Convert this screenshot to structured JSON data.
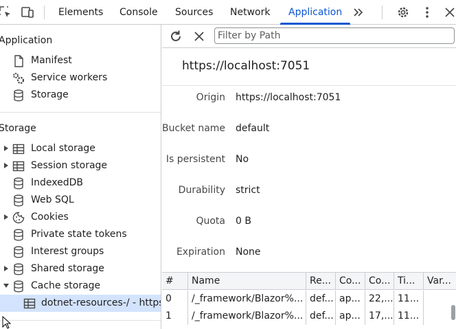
{
  "tabbar": {
    "tabs": [
      "Elements",
      "Console",
      "Sources",
      "Network",
      "Application"
    ],
    "active_tab": "Application",
    "more_label": "»"
  },
  "sidebar": {
    "application_title": "Application",
    "application_items": [
      {
        "label": "Manifest",
        "icon": "file-icon"
      },
      {
        "label": "Service workers",
        "icon": "gears-icon"
      },
      {
        "label": "Storage",
        "icon": "database-icon"
      }
    ],
    "storage_title": "Storage",
    "storage_items": [
      {
        "label": "Local storage",
        "icon": "table-icon",
        "expandable": true
      },
      {
        "label": "Session storage",
        "icon": "table-icon",
        "expandable": true
      },
      {
        "label": "IndexedDB",
        "icon": "database-icon",
        "expandable": false
      },
      {
        "label": "Web SQL",
        "icon": "database-icon",
        "expandable": false
      },
      {
        "label": "Cookies",
        "icon": "cookie-icon",
        "expandable": true
      },
      {
        "label": "Private state tokens",
        "icon": "database-icon",
        "expandable": false
      },
      {
        "label": "Interest groups",
        "icon": "database-icon",
        "expandable": false
      },
      {
        "label": "Shared storage",
        "icon": "database-icon",
        "expandable": true
      },
      {
        "label": "Cache storage",
        "icon": "database-icon",
        "expandable": true,
        "expanded": true
      }
    ],
    "cache_child": {
      "label": "dotnet-resources-/ - https",
      "icon": "table-icon",
      "selected": true
    }
  },
  "toolbar": {
    "filter_placeholder": "Filter by Path"
  },
  "details": {
    "origin_title": "https://localhost:7051",
    "rows": [
      {
        "key": "Origin",
        "value": "https://localhost:7051"
      },
      {
        "key": "Bucket name",
        "value": "default"
      },
      {
        "key": "Is persistent",
        "value": "No"
      },
      {
        "key": "Durability",
        "value": "strict"
      },
      {
        "key": "Quota",
        "value": "0 B"
      },
      {
        "key": "Expiration",
        "value": "None"
      }
    ]
  },
  "table": {
    "headers": [
      "#",
      "Name",
      "Re...",
      "Co...",
      "Co...",
      "Ti...",
      "Var..."
    ],
    "rows": [
      [
        "0",
        "/_framework/Blazor%...",
        "def...",
        "ap...",
        "22,...",
        "11...",
        ""
      ],
      [
        "1",
        "/_framework/Blazor%...",
        "def...",
        "ap...",
        "17,...",
        "11...",
        ""
      ]
    ]
  },
  "colors": {
    "accent": "#0b57d0",
    "selected_bg": "#d3e3fd",
    "border": "#cbcdd1"
  }
}
